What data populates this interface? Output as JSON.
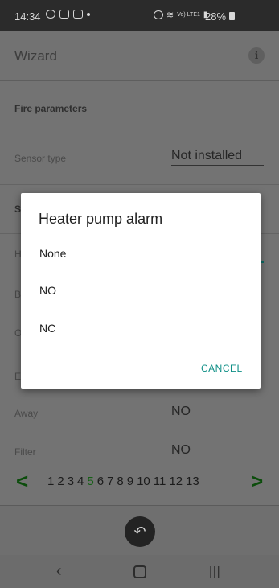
{
  "status_bar": {
    "time": "14:34",
    "battery": "28%",
    "network": "Vo) LTE1",
    "icons": [
      "messenger-icon",
      "gallery-icon",
      "eye-off-icon",
      "dot-icon",
      "alarm-icon",
      "wifi-icon",
      "signal-icon",
      "battery-icon"
    ]
  },
  "app_bar": {
    "title": "Wizard",
    "info_glyph": "i"
  },
  "section": {
    "header": "Fire parameters"
  },
  "rows": {
    "sensor_type": {
      "label": "Sensor type",
      "value": "Not installed"
    },
    "partial_s": {
      "label": "S"
    },
    "partial_h": {
      "label": "H"
    },
    "partial_b": {
      "label": "B"
    },
    "partial_o": {
      "label": "O"
    },
    "partial_e": {
      "label": "E"
    },
    "away": {
      "label": "Away",
      "value": "NO"
    },
    "filter": {
      "label": "Filter",
      "value": "NO"
    }
  },
  "dialog": {
    "title": "Heater pump alarm",
    "options": [
      "None",
      "NO",
      "NC"
    ],
    "cancel": "CANCEL"
  },
  "pager": {
    "prev": "<",
    "next": ">",
    "pages": [
      "1",
      "2",
      "3",
      "4",
      "5",
      "6",
      "7",
      "8",
      "9",
      "10",
      "11",
      "12",
      "13"
    ],
    "active_page": "5"
  },
  "undo_glyph": "↶",
  "nav": {
    "back": "‹",
    "recents": "|||"
  },
  "colors": {
    "accent": "#0e8f86",
    "pager_active": "#145f14",
    "arrows": "#0c4d0c"
  }
}
